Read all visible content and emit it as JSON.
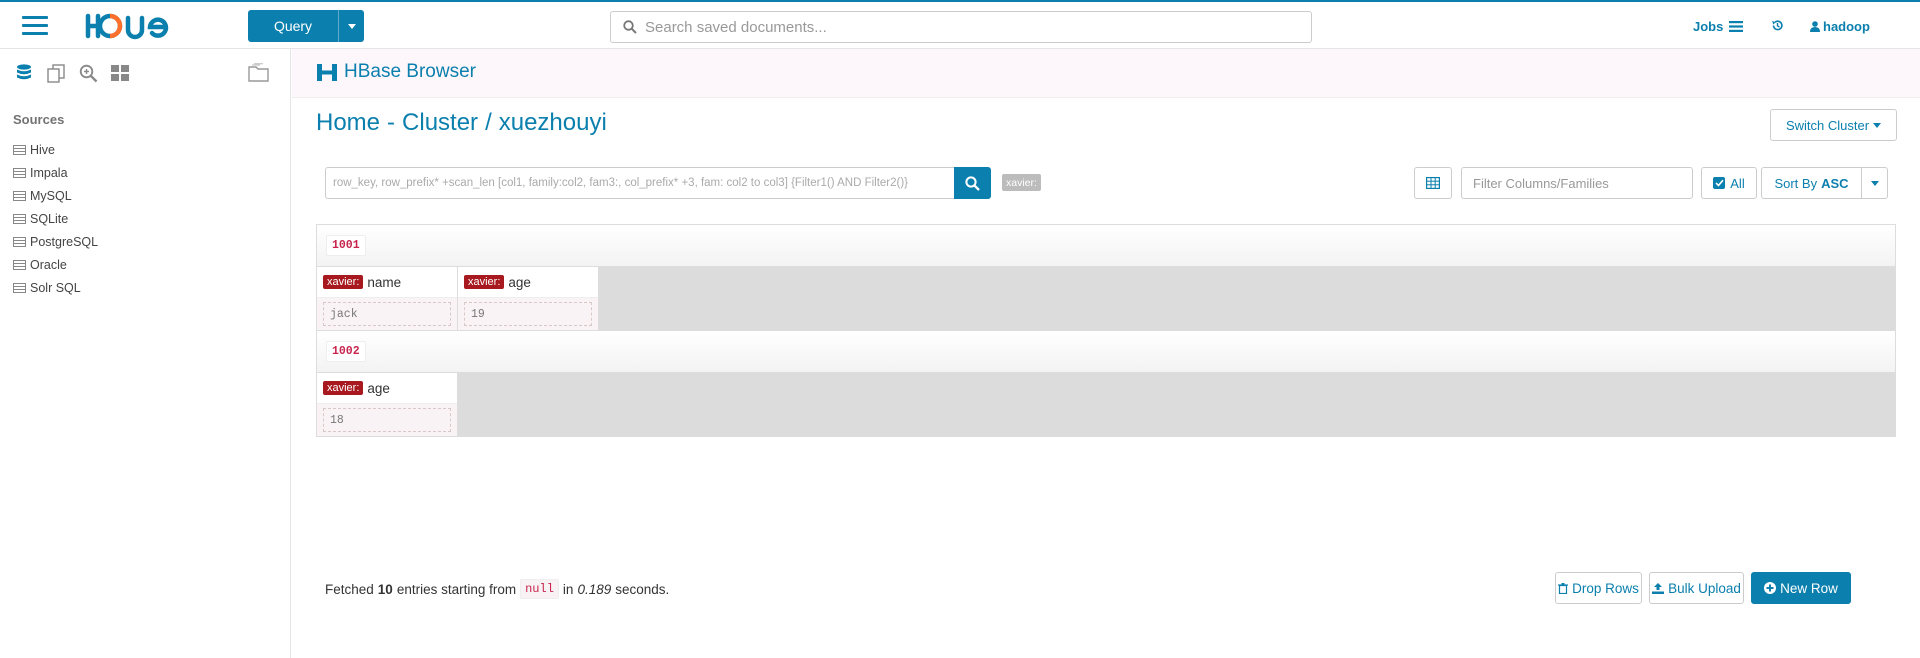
{
  "topbar": {
    "query_label": "Query",
    "search_placeholder": "Search saved documents...",
    "jobs_label": "Jobs",
    "user_label": "hadoop"
  },
  "sidebar": {
    "sources_title": "Sources",
    "sources": [
      "Hive",
      "Impala",
      "MySQL",
      "SQLite",
      "PostgreSQL",
      "Oracle",
      "Solr SQL"
    ]
  },
  "app": {
    "title": "HBase Browser"
  },
  "breadcrumb": {
    "home": "Home",
    "sep1": "-",
    "cluster": "Cluster",
    "sep2": "/",
    "table": "xuezhouyi"
  },
  "toolbar": {
    "switch_cluster": "Switch Cluster",
    "row_search_placeholder": "row_key, row_prefix* +scan_len [col1, family:col2, fam3:, col_prefix* +3, fam: col2 to col3] {Filter1() AND Filter2()}",
    "family_badge": "xavier:",
    "filter_placeholder": "Filter Columns/Families",
    "all_label": "All",
    "sort_label": "Sort By",
    "sort_value": "ASC"
  },
  "rows": [
    {
      "key": "1001",
      "cells": [
        {
          "family": "xavier:",
          "column": "name",
          "value": "jack"
        },
        {
          "family": "xavier:",
          "column": "age",
          "value": "19"
        }
      ]
    },
    {
      "key": "1002",
      "cells": [
        {
          "family": "xavier:",
          "column": "age",
          "value": "18"
        }
      ]
    }
  ],
  "footer": {
    "fetched_prefix": "Fetched",
    "count": "10",
    "mid": "entries starting from",
    "start": "null",
    "in": "in",
    "seconds_value": "0.189",
    "seconds_label": "seconds.",
    "drop_rows": "Drop Rows",
    "bulk_upload": "Bulk Upload",
    "new_row": "New Row"
  },
  "colors": {
    "primary": "#0B7FAD",
    "family_badge": "#a7191e",
    "row_key": "#c7254e"
  }
}
